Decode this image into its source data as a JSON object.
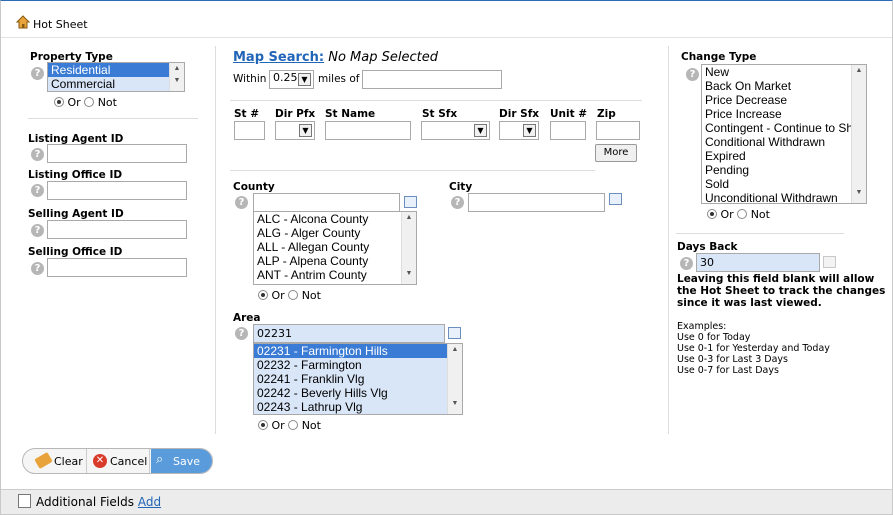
{
  "window": {
    "title": "Hot Sheet"
  },
  "property_type": {
    "label": "Property Type",
    "options": [
      "Residential",
      "Commercial"
    ],
    "selected": "Residential"
  },
  "radio": {
    "or": "Or",
    "not": "Not"
  },
  "listing_agent": {
    "label": "Listing Agent ID",
    "value": ""
  },
  "listing_office": {
    "label": "Listing Office ID",
    "value": ""
  },
  "selling_agent": {
    "label": "Selling Agent ID",
    "value": ""
  },
  "selling_office": {
    "label": "Selling Office ID",
    "value": ""
  },
  "map": {
    "link": "Map Search:",
    "status": "No Map Selected",
    "within_label": "Within",
    "within_value": "0.25",
    "miles_label": "miles of",
    "miles_value": ""
  },
  "address": {
    "st_num": "St #",
    "dir_pfx": "Dir Pfx",
    "st_name": "St Name",
    "st_sfx": "St Sfx",
    "dir_sfx": "Dir Sfx",
    "unit": "Unit #",
    "zip": "Zip",
    "more": "More"
  },
  "county": {
    "label": "County",
    "value": "",
    "options": [
      "ALC - Alcona County",
      "ALG - Alger County",
      "ALL - Allegan County",
      "ALP - Alpena County",
      "ANT - Antrim County"
    ]
  },
  "city": {
    "label": "City",
    "value": ""
  },
  "area": {
    "label": "Area",
    "value": "02231",
    "options": [
      "02231 - Farmington Hills",
      "02232 - Farmington",
      "02241 - Franklin Vlg",
      "02242 - Beverly Hills Vlg",
      "02243 - Lathrup Vlg"
    ],
    "selected": "02231 - Farmington Hills"
  },
  "change_type": {
    "label": "Change Type",
    "options": [
      "New",
      "Back On Market",
      "Price Decrease",
      "Price Increase",
      "Contingent - Continue to Sh",
      "Conditional Withdrawn",
      "Expired",
      "Pending",
      "Sold",
      "Unconditional Withdrawn"
    ]
  },
  "days_back": {
    "label": "Days Back",
    "value": "30",
    "note": "Leaving this field blank will allow the Hot Sheet to track the changes since it was last viewed.",
    "examples_label": "Examples:",
    "examples": [
      "Use 0 for Today",
      "Use 0-1 for Yesterday and Today",
      "Use 0-3 for Last 3 Days",
      "Use 0-7 for Last Days"
    ]
  },
  "buttons": {
    "clear": "Clear",
    "cancel": "Cancel",
    "save": "Save"
  },
  "footer": {
    "label": "Additional Fields",
    "add": "Add"
  },
  "colors": {
    "accent": "#2e6db5",
    "save": "#5a9bdc",
    "cancel": "#d93b2b",
    "highlight": "#3a7bd5"
  }
}
